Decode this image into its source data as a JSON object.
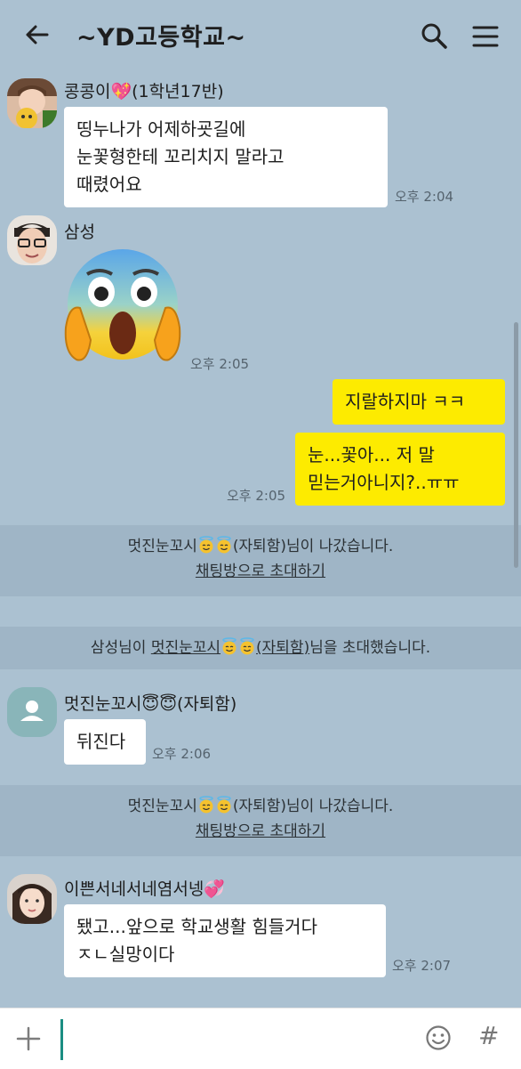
{
  "header": {
    "title": "~YD고등학교~",
    "back_icon": "arrow-left-icon",
    "search_icon": "search-icon",
    "menu_icon": "hamburger-menu-icon"
  },
  "messages": [
    {
      "sender": "콩콩이💖(1학년17반)",
      "text": "띵누나가 어제하굣길에\n눈꽃형한테 꼬리치지 말라고\n때렸어요",
      "time": "오후 2:04"
    },
    {
      "sender": "삼성",
      "sticker": "screaming-face-emoji",
      "time": "오후 2:05"
    },
    {
      "mine": true,
      "text": "지랄하지마 ㅋㅋ",
      "time": ""
    },
    {
      "mine": true,
      "text": "눈...꽃아... 저 말\n믿는거아니지?..ㅠㅠ",
      "time": "오후 2:05"
    },
    {
      "sender": "멋진눈꼬시😇😇(자퇴함)",
      "text": "뒤진다",
      "time": "오후 2:06"
    },
    {
      "sender": "이쁜서네서네염서넹💞",
      "text": "됐고...앞으로 학교생활 힘들거다\nㅈㄴ실망이다",
      "time": "오후 2:07"
    }
  ],
  "system": [
    {
      "prefix": "멋진눈꼬시",
      "suffix": "(자퇴함)님이 나갔습니다.",
      "link": "채팅방으로 초대하기"
    },
    {
      "prefix": "삼성님이 ",
      "name": "멋진눈꼬시",
      "name_suffix": "(자퇴함)",
      "suffix": "님을 초대했습니다."
    },
    {
      "prefix": "멋진눈꼬시",
      "suffix": "(자퇴함)님이 나갔습니다.",
      "link": "채팅방으로 초대하기"
    }
  ],
  "input": {
    "plus_icon": "plus-icon",
    "emoji_icon": "smiley-icon",
    "hash_label": "#"
  },
  "colors": {
    "background": "#abc1d1",
    "my_bubble": "#fdeb00",
    "other_bubble": "#ffffff",
    "cursor": "#1a8d82"
  }
}
